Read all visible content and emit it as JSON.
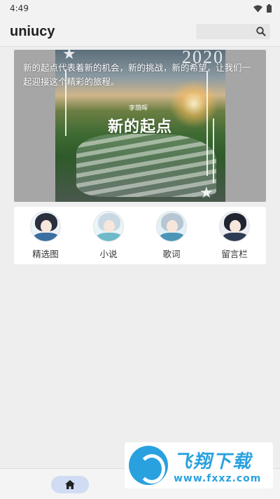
{
  "status_bar": {
    "time": "4:49"
  },
  "app_bar": {
    "title": "uniucy"
  },
  "banner": {
    "caption": "新的起点代表着新的机会，新的挑战，新的希望，让我们一起迎接这个精彩的旅程。",
    "image_stamp": "李荫晖",
    "image_heading": "新的起点",
    "image_year": "2020"
  },
  "quick_menu": [
    {
      "label": "精选图",
      "icon": "avatar-anime-girl",
      "accent": "#3b6fa0"
    },
    {
      "label": "小说",
      "icon": "avatar-anime-girl",
      "accent": "#6fb9c9"
    },
    {
      "label": "歌词",
      "icon": "avatar-anime-girl",
      "accent": "#4b96b8"
    },
    {
      "label": "留言栏",
      "icon": "avatar-anime-girl",
      "accent": "#2f3b52"
    }
  ],
  "bottom_nav": {
    "active": "home-icon"
  },
  "watermark": {
    "brand": "飞翔下载",
    "url": "www.fxxz.com"
  },
  "colors": {
    "active_pill": "#cfdcf3",
    "background": "#eeeeee",
    "watermark_blue": "#2aa1df"
  }
}
